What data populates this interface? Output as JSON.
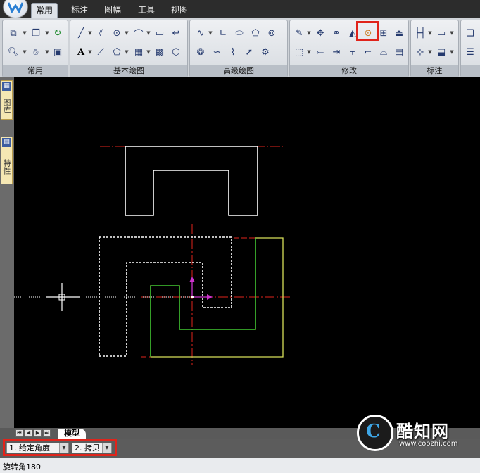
{
  "ribbon_tabs": [
    "常用",
    "标注",
    "图幅",
    "工具",
    "视图"
  ],
  "active_tab": "常用",
  "ribbon_groups": [
    "常用",
    "基本绘图",
    "高级绘图",
    "修改",
    "标注"
  ],
  "side_panels": [
    "图库",
    "特性"
  ],
  "layout_tab": "模型",
  "command_options": {
    "option1": "1. 给定角度",
    "option2": "2. 拷贝"
  },
  "status_text": "旋转角180",
  "watermark": {
    "name": "酷知网",
    "url": "www.coozhi.com"
  },
  "colors": {
    "highlight": "#e0241b",
    "canvas_bg": "#000000",
    "centerline": "#e0241b",
    "selected_outline": "#ffffff",
    "green_geometry": "#2fd02f",
    "yellow_geometry": "#d8e05a",
    "grip_arrow": "#cc33cc"
  },
  "icons": {
    "highlighted_tool": "rotate-icon"
  }
}
